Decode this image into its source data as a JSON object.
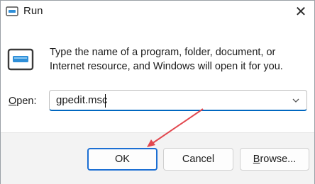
{
  "window": {
    "title": "Run",
    "close_icon": "close-icon"
  },
  "description": {
    "line1": "Type the name of a program, folder, document, or",
    "line2": "Internet resource, and Windows will open it for you."
  },
  "open_field": {
    "label_underlined": "O",
    "label_rest": "pen:",
    "value": "gpedit.msc"
  },
  "buttons": {
    "ok": "OK",
    "cancel": "Cancel",
    "browse_underlined": "B",
    "browse_rest": "rowse..."
  },
  "colors": {
    "accent": "#1c6fd3",
    "annotation_arrow": "#e2484f",
    "icon_blue": "#2f8fd8"
  },
  "icons": [
    "run-icon",
    "close-icon",
    "chevron-down-icon",
    "annotation-arrow"
  ]
}
